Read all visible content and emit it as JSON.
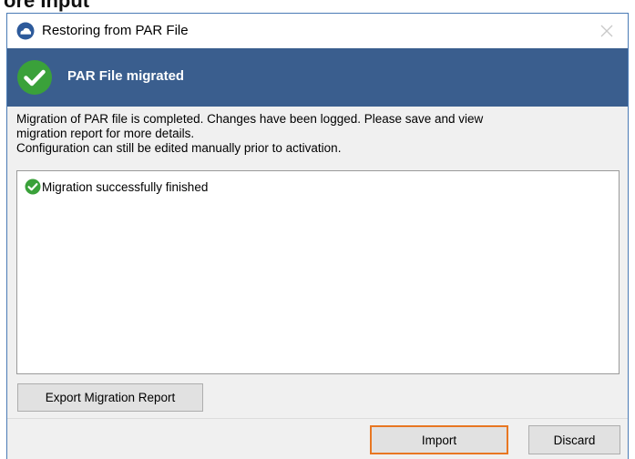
{
  "background": {
    "partial_text": "ore Input"
  },
  "window": {
    "title": "Restoring from PAR File",
    "icon": "app-cloud-icon",
    "close_icon": "close-icon"
  },
  "banner": {
    "title": "PAR File migrated",
    "icon": "success-check-icon",
    "color": "#3a5e8e"
  },
  "message": {
    "line1": "Migration of PAR file is completed. Changes have been logged. Please save and view",
    "line2": "migration report for more details.",
    "line3": "Configuration can still be edited manually prior to activation."
  },
  "log": {
    "entries": [
      {
        "icon": "success-check-icon",
        "text": "Migration successfully finished"
      }
    ]
  },
  "buttons": {
    "export_label": "Export Migration Report",
    "import_label": "Import",
    "discard_label": "Discard"
  },
  "colors": {
    "success_green": "#3aa13a",
    "focus_outline": "#e87722"
  }
}
